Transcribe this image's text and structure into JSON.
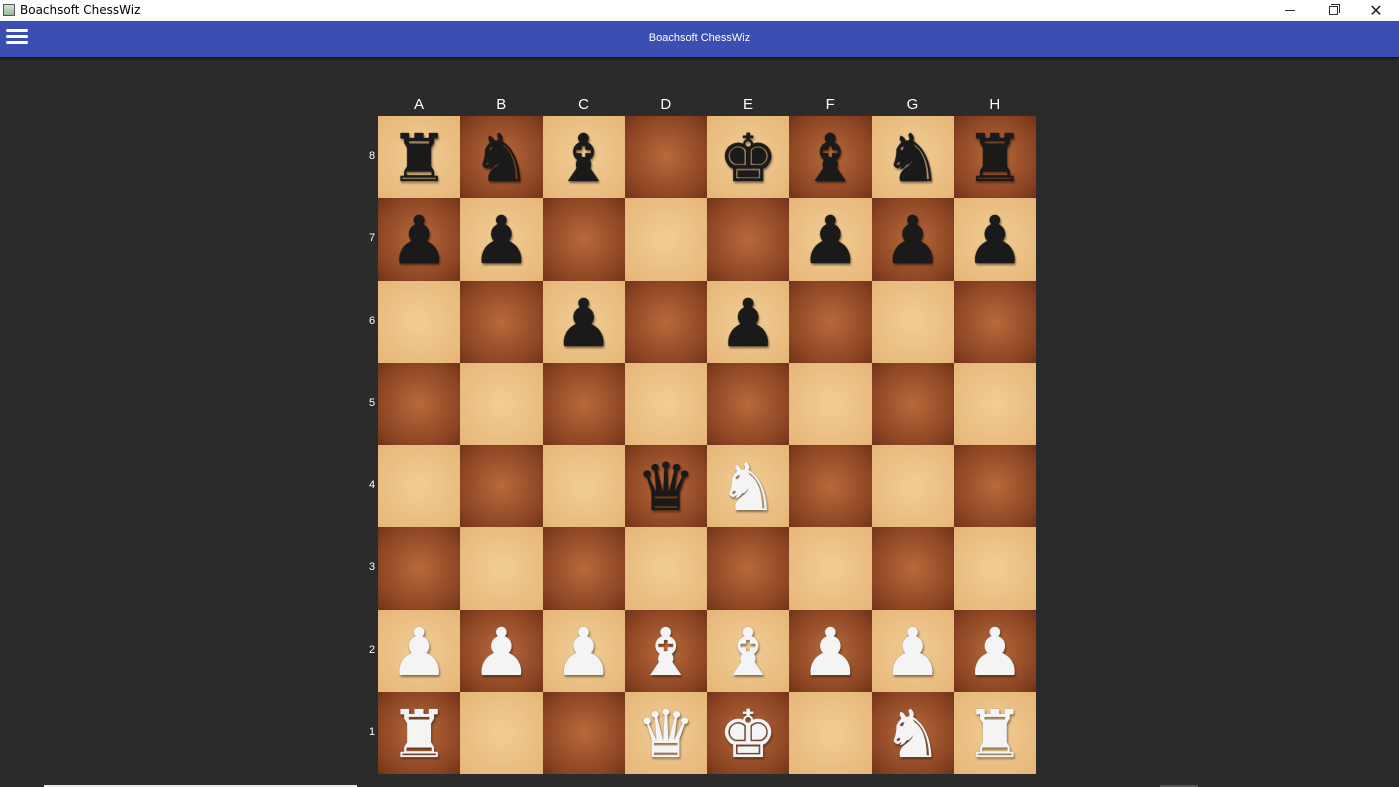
{
  "window": {
    "title": "Boachsoft ChessWiz",
    "minimize_icon": "minimize-icon",
    "maximize_icon": "restore-icon",
    "close_icon": "close-icon"
  },
  "appbar": {
    "title": "Boachsoft ChessWiz",
    "menu_icon": "hamburger-menu-icon",
    "color": "#3b4fb3"
  },
  "board": {
    "files": [
      "A",
      "B",
      "C",
      "D",
      "E",
      "F",
      "G",
      "H"
    ],
    "ranks": [
      "8",
      "7",
      "6",
      "5",
      "4",
      "3",
      "2",
      "1"
    ],
    "light_color": "#e9bc80",
    "dark_color": "#9a4f28",
    "rows": [
      [
        "br",
        "bn",
        "bb",
        "",
        "bk",
        "bb",
        "bn",
        "br"
      ],
      [
        "bp",
        "bp",
        "",
        "",
        "",
        "bp",
        "bp",
        "bp"
      ],
      [
        "",
        "",
        "bp",
        "",
        "bp",
        "",
        "",
        ""
      ],
      [
        "",
        "",
        "",
        "",
        "",
        "",
        "",
        ""
      ],
      [
        "",
        "",
        "",
        "bq",
        "wn",
        "",
        "",
        ""
      ],
      [
        "",
        "",
        "",
        "",
        "",
        "",
        "",
        ""
      ],
      [
        "wp",
        "wp",
        "wp",
        "wb",
        "wb",
        "wp",
        "wp",
        "wp"
      ],
      [
        "wr",
        "",
        "",
        "wq",
        "wk",
        "",
        "wn",
        "wr"
      ]
    ]
  },
  "pieces": {
    "k": {
      "glyph": "♚",
      "name": "king"
    },
    "q": {
      "glyph": "♛",
      "name": "queen"
    },
    "r": {
      "glyph": "♜",
      "name": "rook"
    },
    "b": {
      "glyph": "♝",
      "name": "bishop"
    },
    "n": {
      "glyph": "♞",
      "name": "knight"
    },
    "p": {
      "glyph": "♟",
      "name": "pawn"
    }
  }
}
